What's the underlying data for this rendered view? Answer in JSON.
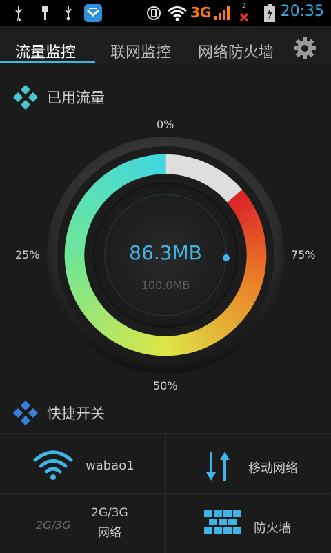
{
  "status_bar": {
    "network_type": "3G",
    "sim_indicator": "2",
    "time": "20:35",
    "icons": [
      "usb-icon",
      "usb-icon",
      "usb-icon",
      "app-shield-icon",
      "vpn-icon",
      "wifi-icon",
      "signal-icon",
      "no-sim-icon",
      "battery-charging-icon"
    ],
    "time_color": "#39a9e0"
  },
  "tabs": [
    {
      "label": "流量监控",
      "active": true
    },
    {
      "label": "联网监控",
      "active": false
    },
    {
      "label": "网络防火墙",
      "active": false
    }
  ],
  "sections": {
    "usage_title": "已用流量",
    "quick_title": "快捷开关"
  },
  "gauge": {
    "label_top": "0%",
    "label_left": "25%",
    "label_right": "75%",
    "label_bottom": "50%",
    "used": "86.3MB",
    "total": "100.0MB",
    "used_fraction": 0.863
  },
  "quick_switches": {
    "wifi_label": "wabao1",
    "mobile_label": "移动网络",
    "mode_badge": "2G/3G",
    "mode_label_line1": "2G/3G",
    "mode_label_line2": "网络",
    "firewall_label": "防火墙"
  },
  "colors": {
    "accent": "#3fb4e6",
    "background": "#1b1b1b"
  }
}
